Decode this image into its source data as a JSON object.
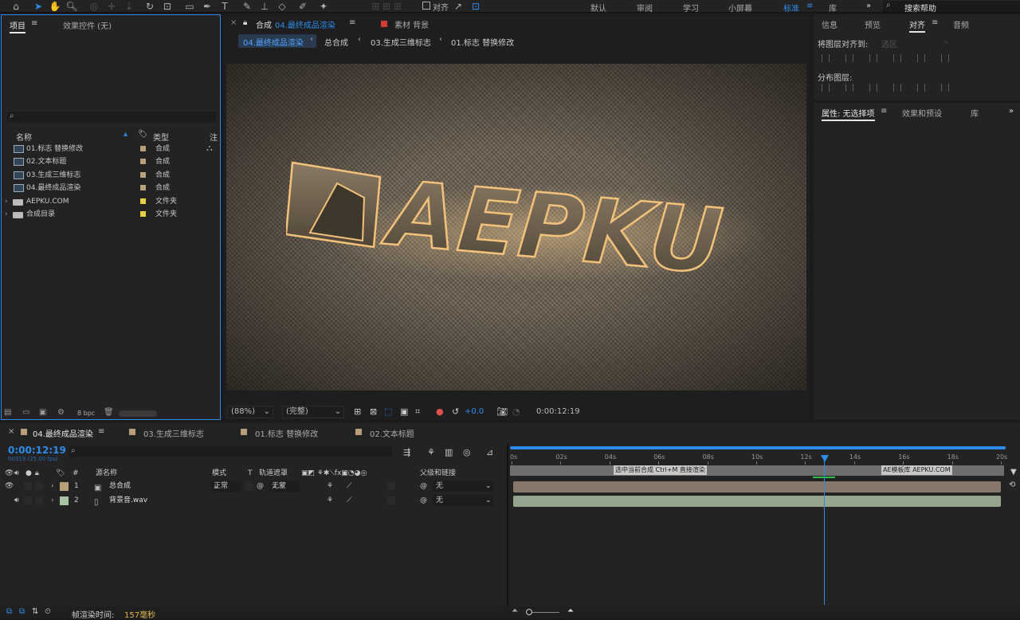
{
  "toolbar": {
    "snap_label": "对齐",
    "workspaces": [
      "默认",
      "审阅",
      "学习",
      "小屏幕",
      "标准",
      "库"
    ],
    "active_workspace": "标准",
    "search_help": "搜索帮助"
  },
  "project_panel": {
    "tabs": [
      "项目",
      "效果控件 (无)"
    ],
    "search_placeholder": "",
    "columns": {
      "name": "名称",
      "type": "类型",
      "comment": "注"
    },
    "items": [
      {
        "name": "01.标志 替换修改",
        "type": "合成",
        "kind": "comp",
        "color": "#b8a07a"
      },
      {
        "name": "02.文本标题",
        "type": "合成",
        "kind": "comp",
        "color": "#b8a07a"
      },
      {
        "name": "03.生成三维标志",
        "type": "合成",
        "kind": "comp",
        "color": "#b8a07a"
      },
      {
        "name": "04.最终成品渲染",
        "type": "合成",
        "kind": "comp",
        "color": "#b8a07a"
      },
      {
        "name": "AEPKU.COM",
        "type": "文件夹",
        "kind": "folder",
        "color": "#e3cf46"
      },
      {
        "name": "合成目录",
        "type": "文件夹",
        "kind": "folder",
        "color": "#e3cf46"
      }
    ],
    "bpc": "8 bpc"
  },
  "comp_panel": {
    "tab_prefix": "合成",
    "tab_name": "04.最终成品渲染",
    "footage_tab": "素材 背景",
    "breadcrumbs": [
      "04.最终成品渲染",
      "总合成",
      "03.生成三维标志",
      "01.标志 替换修改"
    ],
    "logo_text": "AEPKU",
    "zoom": "(88%)",
    "resolution": "(完整)",
    "exposure": "+0.0",
    "timecode": "0:00:12:19"
  },
  "right_panel": {
    "tabs": [
      "信息",
      "预览",
      "对齐",
      "音频"
    ],
    "align_to_label": "将图层对齐到:",
    "align_to_value": "选区",
    "distribute_label": "分布图层:",
    "props_tabs": [
      "属性: 无选择项",
      "效果和预设",
      "库"
    ]
  },
  "timeline": {
    "tabs": [
      "04.最终成品渲染",
      "03.生成三维标志",
      "01.标志 替换修改",
      "02.文本标题"
    ],
    "timecode": "0:00:12:19",
    "frame_info": "00319 (25.00 fps)",
    "columns": {
      "num": "#",
      "source": "源名称",
      "mode": "模式",
      "t": "T",
      "track_matte": "轨道遮罩",
      "parent": "父级和链接"
    },
    "layers": [
      {
        "num": "1",
        "name": "总合成",
        "mode": "正常",
        "matte": "无蒙",
        "parent": "无",
        "color": "#b8a07a",
        "bar": "#86786a"
      },
      {
        "num": "2",
        "name": "背景音.wav",
        "mode": "",
        "matte": "",
        "parent": "无",
        "color": "#a9c2a3",
        "bar": "#95a58e"
      }
    ],
    "ruler": [
      "0s",
      "02s",
      "04s",
      "06s",
      "08s",
      "10s",
      "12s",
      "14s",
      "16s",
      "18s",
      "20s"
    ],
    "markers": [
      "选中当前合成 Ctrl+M 直接渲染",
      "AE模板库 AEPKU.COM"
    ],
    "render_time_label": "帧渲染时间:",
    "render_time_value": "157毫秒"
  }
}
